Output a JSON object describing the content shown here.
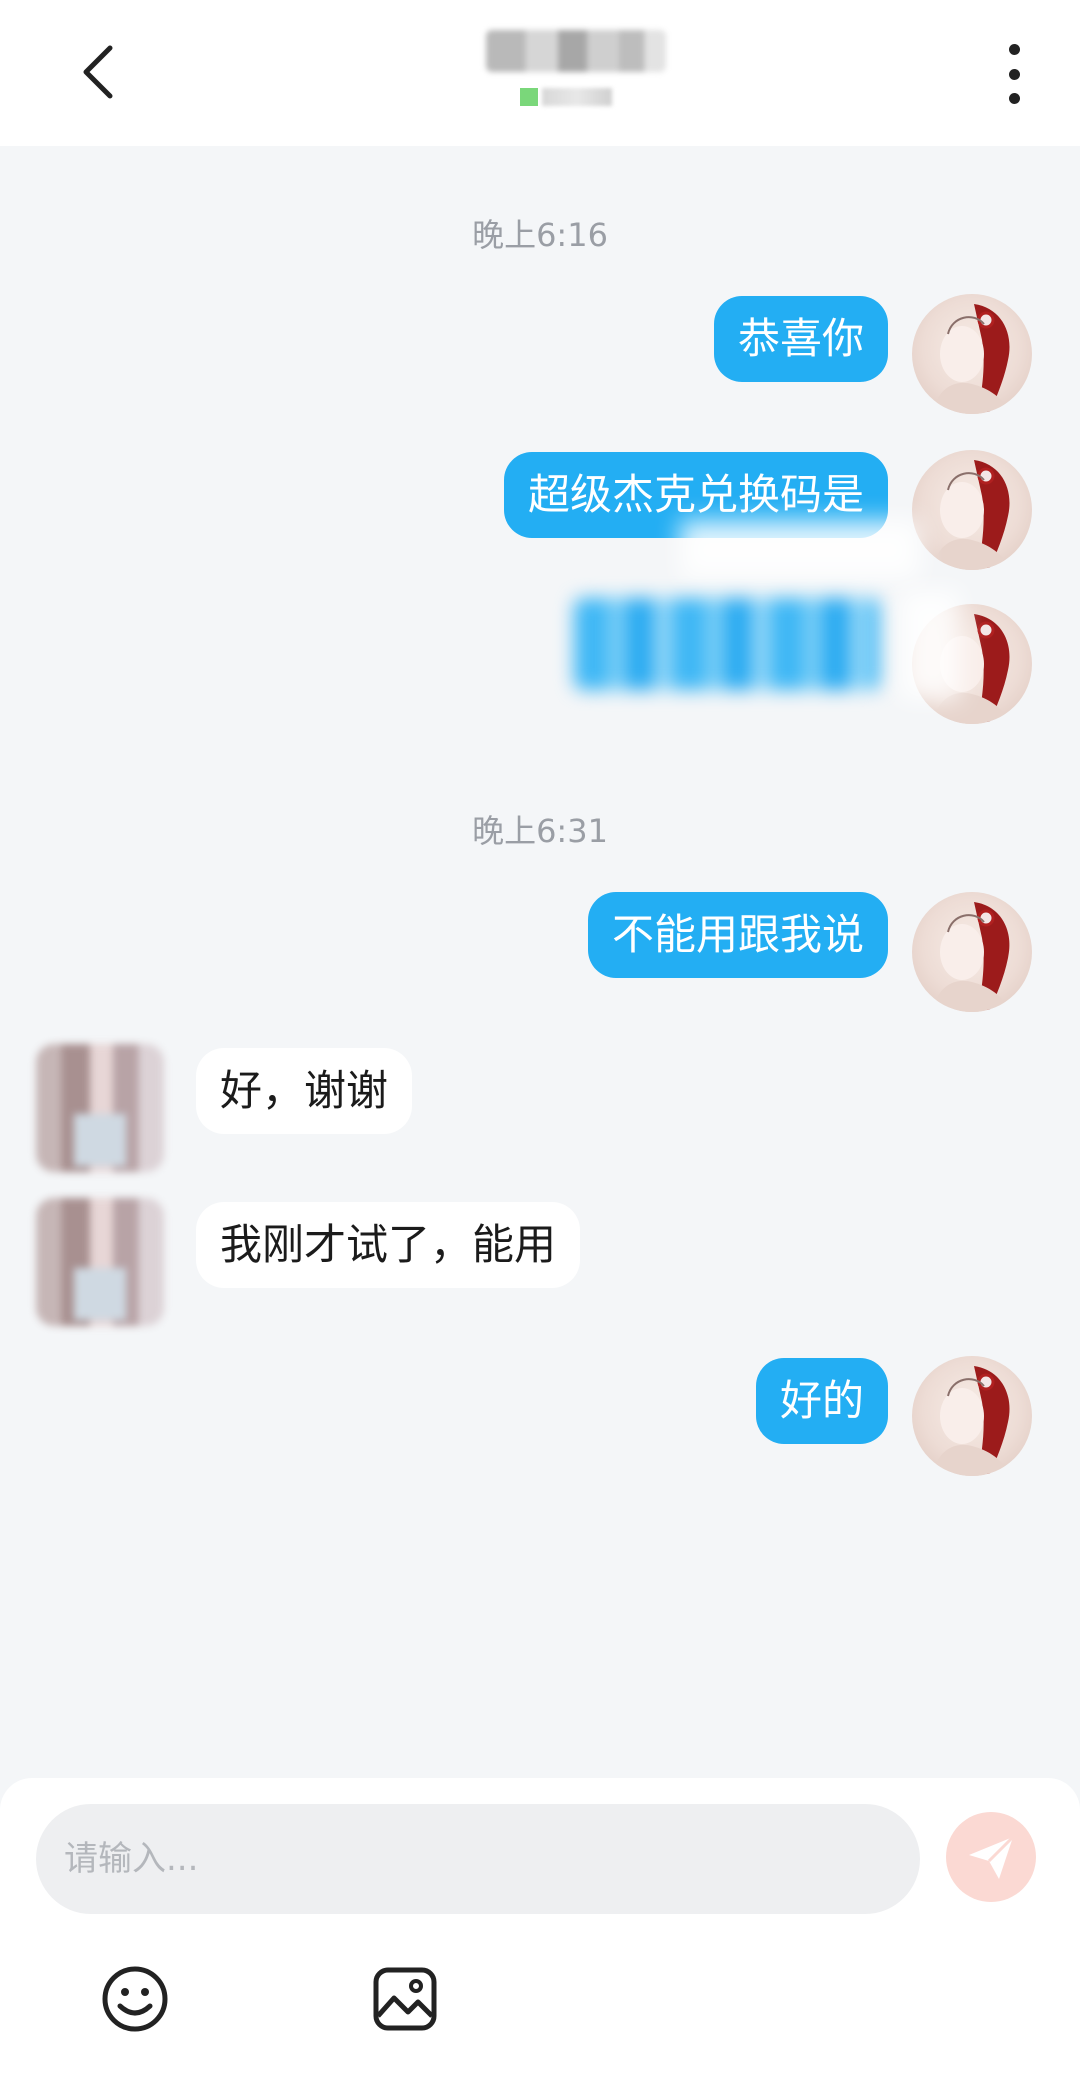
{
  "header": {
    "title": "",
    "status": ""
  },
  "chat": {
    "timestamps": [
      "晚上6:16",
      "晚上6:31"
    ],
    "messages": [
      {
        "side": "out",
        "text": "恭喜你"
      },
      {
        "side": "out",
        "text": "超级杰克兑换码是"
      },
      {
        "side": "out",
        "text": ""
      },
      {
        "side": "out",
        "text": "不能用跟我说"
      },
      {
        "side": "in",
        "text": "好，谢谢"
      },
      {
        "side": "in",
        "text": "我刚才试了，能用"
      },
      {
        "side": "out",
        "text": "好的"
      }
    ]
  },
  "composer": {
    "placeholder": "请输入..."
  },
  "icons": {
    "back": "back-arrow-icon",
    "more": "more-vertical-icon",
    "send": "send-icon",
    "emoji": "emoji-icon",
    "image": "image-icon"
  },
  "colors": {
    "background": "#f4f6f8",
    "outgoing_bubble": "#23aef3",
    "incoming_bubble": "#ffffff",
    "send_button": "#fbd9d3"
  }
}
